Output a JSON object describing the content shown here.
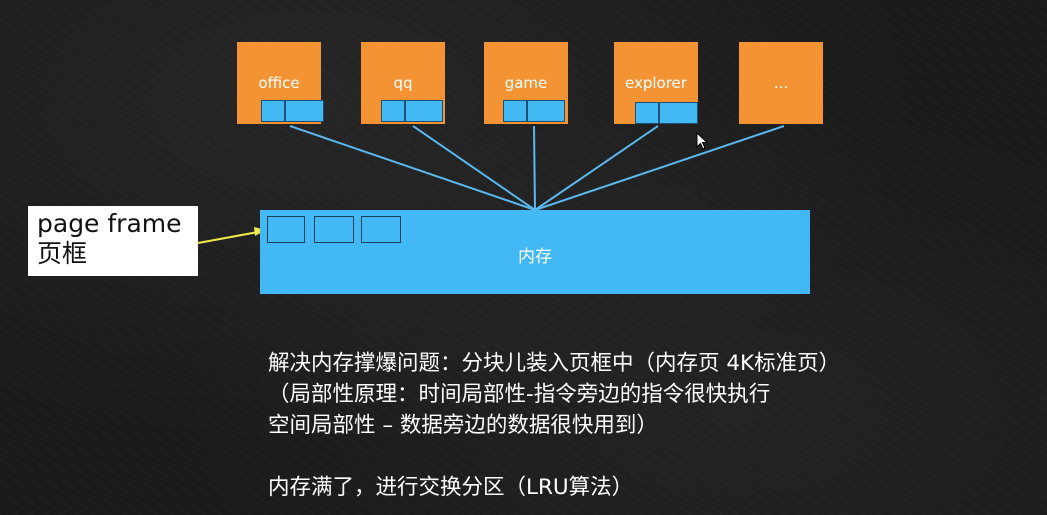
{
  "processes": [
    {
      "label": "office"
    },
    {
      "label": "qq"
    },
    {
      "label": "game"
    },
    {
      "label": "explorer"
    },
    {
      "label": "..."
    }
  ],
  "memory": {
    "label": "内存"
  },
  "callout": {
    "line1": "page frame",
    "line2": "页框"
  },
  "notes": [
    "解决内存撑爆问题：分块儿装入页框中（内存页 4K标准页）",
    "（局部性原理：时间局部性-指令旁边的指令很快执行",
    "空间局部性 – 数据旁边的数据很快用到）",
    "",
    "内存满了，进行交换分区（LRU算法）"
  ],
  "colors": {
    "process": "#f39333",
    "memory": "#42b9f5",
    "link": "#5ab8f0",
    "arrow": "#f2e84a",
    "background": "#1a1a1a"
  }
}
